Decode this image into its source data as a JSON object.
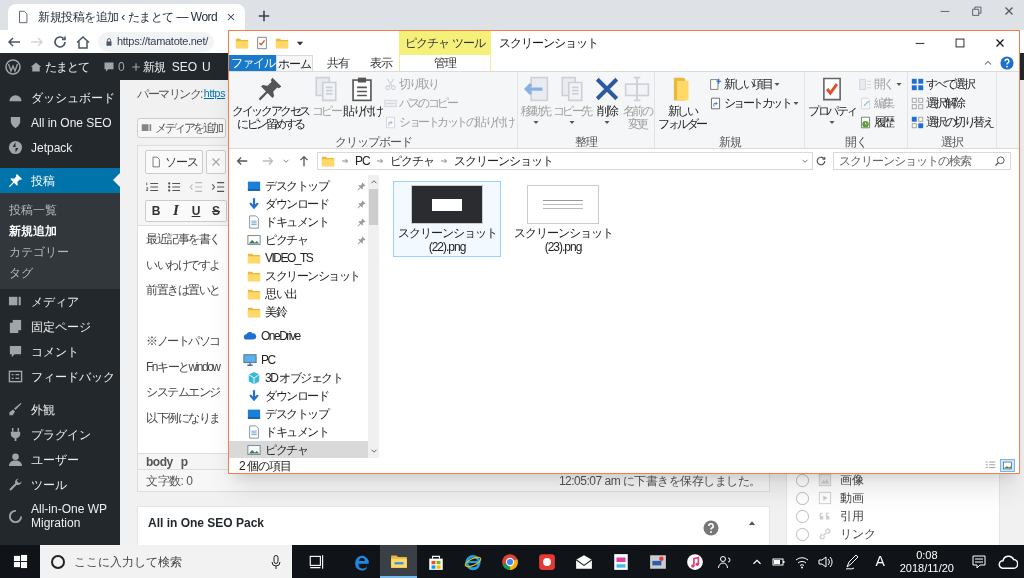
{
  "browser": {
    "tab_title": "新規投稿を追加 ‹ たまとて — Word",
    "url": "https://tamatote.net/"
  },
  "admin_bar": {
    "site": "たまとて",
    "comments": "0",
    "new": "新規",
    "seo": "SEO",
    "item_cut": "U"
  },
  "sidebar": {
    "items": [
      {
        "kind": "dashboard",
        "label": "ダッシュボード",
        "selected": false
      },
      {
        "kind": "shield",
        "label": "All in One SEO",
        "selected": false
      },
      {
        "kind": "bolt",
        "label": "Jetpack",
        "selected": false
      },
      {
        "kind": "separator"
      },
      {
        "kind": "pin",
        "label": "投稿",
        "selected": true,
        "children": [
          {
            "label": "投稿一覧",
            "selected": false
          },
          {
            "label": "新規追加",
            "selected": true
          },
          {
            "label": "カテゴリー",
            "selected": false
          },
          {
            "label": "タグ",
            "selected": false
          }
        ]
      },
      {
        "kind": "media",
        "label": "メディア",
        "selected": false
      },
      {
        "kind": "pages",
        "label": "固定ページ",
        "selected": false
      },
      {
        "kind": "comment",
        "label": "コメント",
        "selected": false
      },
      {
        "kind": "form",
        "label": "フィードバック",
        "selected": false
      },
      {
        "kind": "separator"
      },
      {
        "kind": "brush",
        "label": "外観",
        "selected": false
      },
      {
        "kind": "plug",
        "label": "プラグイン",
        "selected": false
      },
      {
        "kind": "user",
        "label": "ユーザー",
        "selected": false
      },
      {
        "kind": "wrench",
        "label": "ツール",
        "selected": false
      },
      {
        "kind": "ring",
        "label": "All-in-One WP Migration",
        "selected": false
      }
    ]
  },
  "editor": {
    "permalink_label": "パーマリンク:",
    "permalink_link": "https",
    "add_media": "メディアを追加",
    "source_button": "ソース",
    "format_buttons": [
      {
        "kind": "bold",
        "label": "B"
      },
      {
        "kind": "italic",
        "label": "I"
      },
      {
        "kind": "underline",
        "label": "U"
      },
      {
        "kind": "strike",
        "label": "S"
      }
    ],
    "paragraphs": [
      {
        "kind": "text",
        "text": "最近記事を書く"
      },
      {
        "kind": "text",
        "text": "いいわけですよ"
      },
      {
        "kind": "text",
        "text": "前置きは置いと"
      },
      {
        "kind": "empty"
      },
      {
        "kind": "text",
        "text": "※ノートパソコ"
      },
      {
        "kind": "text",
        "text": "Fnキーとwindow"
      },
      {
        "kind": "text",
        "text": "システムエンジ"
      },
      {
        "kind": "text",
        "text": "以下例になりま"
      }
    ],
    "path": [
      "body",
      "p"
    ],
    "word_count": "文字数: 0",
    "saved_message": "12:05:07 am に下書きを保存しました。"
  },
  "seo_box": {
    "title": "All in One SEO Pack"
  },
  "format_box": {
    "options": [
      {
        "kind": "image",
        "label": "画像",
        "selected": false
      },
      {
        "kind": "video",
        "label": "動画",
        "selected": false
      },
      {
        "kind": "quote",
        "label": "引用",
        "selected": false
      },
      {
        "kind": "link",
        "label": "リンク",
        "selected": false
      }
    ]
  },
  "explorer": {
    "title": "スクリーンショット",
    "context_tab": "ピクチャ ツール",
    "tabs": [
      {
        "kind": "file",
        "label": "ファイル",
        "selected": false
      },
      {
        "kind": "normal",
        "label": "ホーム",
        "selected": true
      },
      {
        "kind": "normal",
        "label": "共有",
        "selected": false
      },
      {
        "kind": "normal",
        "label": "表示",
        "selected": false
      },
      {
        "kind": "context",
        "label": "管理",
        "selected": false
      }
    ],
    "ribbon": [
      {
        "label": "クリップボード",
        "large": [
          {
            "kind": "pin",
            "lines": [
              "クイック アクセス",
              "にピン留めする"
            ],
            "disabled": false,
            "menu": false
          },
          {
            "kind": "copy",
            "lines": [
              "コピー"
            ],
            "disabled": true,
            "menu": false
          },
          {
            "kind": "paste",
            "lines": [
              "貼り付け"
            ],
            "disabled": false,
            "menu": false
          }
        ],
        "small": [
          {
            "kind": "scissors",
            "label": "切り取り",
            "disabled": true,
            "menu": false
          },
          {
            "kind": "path",
            "label": "パスのコピー",
            "disabled": true,
            "menu": false
          },
          {
            "kind": "shortcut",
            "label": "ショートカットの貼り付け",
            "disabled": true,
            "menu": false
          }
        ]
      },
      {
        "label": "整理",
        "large": [
          {
            "kind": "moveto",
            "lines": [
              "移動先"
            ],
            "disabled": true,
            "menu": true
          },
          {
            "kind": "copy",
            "lines": [
              "コピー先"
            ],
            "disabled": true,
            "menu": true
          },
          {
            "kind": "delete",
            "lines": [
              "削除"
            ],
            "disabled": false,
            "menu": true
          },
          {
            "kind": "rename",
            "lines": [
              "名前の",
              "変更"
            ],
            "disabled": true,
            "menu": false
          }
        ]
      },
      {
        "label": "新規",
        "large": [
          {
            "kind": "newfolder",
            "lines": [
              "新しい",
              "フォルダー"
            ],
            "disabled": false,
            "menu": false
          }
        ],
        "small": [
          {
            "kind": "newitem",
            "label": "新しい項目",
            "disabled": false,
            "menu": true
          },
          {
            "kind": "shortcut",
            "label": "ショートカット",
            "disabled": false,
            "menu": true
          }
        ]
      },
      {
        "label": "開く",
        "large": [
          {
            "kind": "properties",
            "lines": [
              "プロパティ"
            ],
            "disabled": false,
            "menu": true
          }
        ],
        "small": [
          {
            "kind": "open",
            "label": "開く",
            "disabled": true,
            "menu": true
          },
          {
            "kind": "edit",
            "label": "編集",
            "disabled": true,
            "menu": false
          },
          {
            "kind": "history",
            "label": "履歴",
            "disabled": false,
            "menu": false
          }
        ]
      },
      {
        "label": "選択",
        "small": [
          {
            "kind": "selectall",
            "label": "すべて選択",
            "disabled": false,
            "menu": false
          },
          {
            "kind": "selectnone",
            "label": "選択解除",
            "disabled": false,
            "menu": false
          },
          {
            "kind": "invert",
            "label": "選択の切り替え",
            "disabled": false,
            "menu": false
          }
        ]
      }
    ],
    "breadcrumb": [
      "PC",
      "ピクチャ",
      "スクリーンショット"
    ],
    "search": {
      "placeholder": "スクリーンショットの検索"
    },
    "nav": [
      {
        "children": [
          {
            "kind": "desktop",
            "label": "デスクトップ",
            "pinned": true,
            "selected": false
          },
          {
            "kind": "download",
            "label": "ダウンロード",
            "pinned": true,
            "selected": false
          },
          {
            "kind": "document",
            "label": "ドキュメント",
            "pinned": true,
            "selected": false
          },
          {
            "kind": "pictures",
            "label": "ピクチャ",
            "pinned": true,
            "selected": false
          },
          {
            "kind": "folder",
            "label": "VIDEO_TS",
            "pinned": false,
            "selected": false
          },
          {
            "kind": "folder",
            "label": "スクリーンショット",
            "pinned": false,
            "selected": false
          },
          {
            "kind": "folder",
            "label": "思い出",
            "pinned": false,
            "selected": false
          },
          {
            "kind": "folder",
            "label": "美鈴",
            "pinned": false,
            "selected": false
          }
        ]
      },
      {
        "kind": "cloud",
        "label": "OneDrive",
        "pinned": false,
        "selected": false
      },
      {
        "kind": "pc",
        "label": "PC",
        "pinned": false,
        "selected": false,
        "children": [
          {
            "kind": "cube",
            "label": "3D オブジェクト",
            "pinned": false,
            "selected": false
          },
          {
            "kind": "download",
            "label": "ダウンロード",
            "pinned": false,
            "selected": false
          },
          {
            "kind": "desktop",
            "label": "デスクトップ",
            "pinned": false,
            "selected": false
          },
          {
            "kind": "document",
            "label": "ドキュメント",
            "pinned": false,
            "selected": false
          },
          {
            "kind": "pictures",
            "label": "ピクチャ",
            "pinned": false,
            "selected": true
          }
        ]
      }
    ],
    "files": [
      {
        "kind": "dark",
        "name": "スクリーンショット\n(22).png",
        "selected": true
      },
      {
        "kind": "light",
        "name": "スクリーンショット\n(23).png",
        "selected": false
      }
    ],
    "status": "2 個の項目",
    "views": [
      {
        "kind": "details",
        "selected": false
      },
      {
        "kind": "thumbnails",
        "selected": true
      }
    ]
  },
  "taskbar": {
    "search_placeholder": "ここに入力して検索",
    "apps": [
      {
        "kind": "taskview",
        "active": false
      },
      {
        "kind": "edge",
        "active": false
      },
      {
        "kind": "explorer",
        "active": true
      },
      {
        "kind": "store",
        "active": false
      },
      {
        "kind": "ie",
        "active": false
      },
      {
        "kind": "chrome",
        "active": false
      },
      {
        "kind": "red",
        "active": false
      },
      {
        "kind": "mail",
        "active": false
      },
      {
        "kind": "notes",
        "active": false
      },
      {
        "kind": "gadget",
        "active": false
      },
      {
        "kind": "music",
        "active": false
      }
    ],
    "ime": "A",
    "time": "0:08",
    "date": "2018/11/20"
  }
}
